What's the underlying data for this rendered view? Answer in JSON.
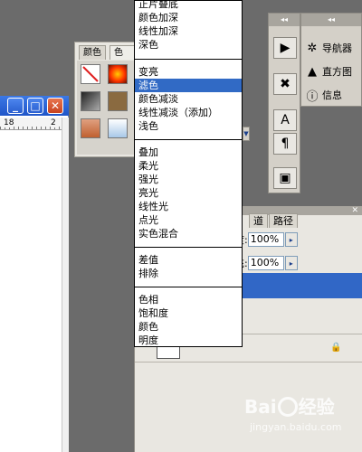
{
  "document_window": {
    "ruler_numbers": [
      "18",
      "2"
    ],
    "buttons": {
      "minimize": "_",
      "restore": "□",
      "close": "✕"
    }
  },
  "swatch_panel": {
    "tabs": [
      "颜色",
      "色板"
    ],
    "swatch_colors": [
      "#ff3300",
      "#cc2200",
      "#555555",
      "#8a6a40",
      "#c08060",
      "#a8c8e8"
    ]
  },
  "dock": {
    "buttons": [
      "play-icon",
      "tool-icon",
      "text-icon",
      "paragraph-icon",
      "layer-comps-icon"
    ],
    "glyphs": [
      "▶",
      "✖",
      "A",
      "¶",
      "▣"
    ]
  },
  "nav_panel": {
    "items": [
      {
        "label": "导航器",
        "icon": "navigator-icon",
        "glyph": "✲"
      },
      {
        "label": "直方图",
        "icon": "histogram-icon",
        "glyph": "▲"
      },
      {
        "label": "信息",
        "icon": "info-icon",
        "glyph": "ⓘ"
      }
    ]
  },
  "layers_panel": {
    "tabs": [
      "道",
      "路径"
    ],
    "opacity_label": "度:",
    "opacity_value": "100%",
    "fill_label": "充:",
    "fill_value": "100%",
    "arrow": "▸",
    "lock_glyph": "🔒"
  },
  "blend_menu": {
    "selected": "滤色",
    "groups": [
      [
        "正片叠底",
        "颜色加深",
        "线性加深",
        "深色"
      ],
      [
        "变亮",
        "滤色",
        "颜色减淡",
        "线性减淡（添加）",
        "浅色"
      ],
      [
        "叠加",
        "柔光",
        "强光",
        "亮光",
        "线性光",
        "点光",
        "实色混合"
      ],
      [
        "差值",
        "排除"
      ],
      [
        "色相",
        "饱和度",
        "颜色",
        "明度"
      ]
    ]
  },
  "watermark": {
    "main_left": "Bai",
    "main_right": "经验",
    "sub": "jingyan.baidu.com"
  },
  "colors": {
    "menu_highlight": "#316ac5",
    "titlebar": "#2a5fd0",
    "layer_selected": "#3167c6"
  }
}
